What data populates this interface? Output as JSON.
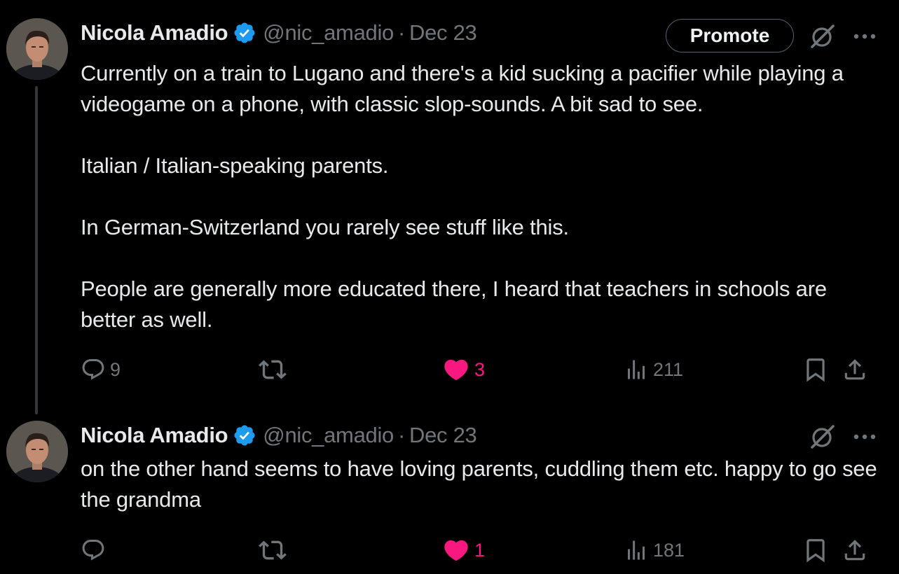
{
  "tweets": [
    {
      "author": {
        "name": "Nicola Amadio",
        "handle": "@nic_amadio",
        "verified": true
      },
      "separator": "·",
      "date": "Dec 23",
      "promote_label": "Promote",
      "paragraphs": [
        "Currently on a train to Lugano and there's a kid sucking a pacifier while playing a videogame on a phone, with classic slop-sounds. A bit sad to see.",
        "Italian / Italian-speaking parents.",
        "In German-Switzerland you rarely see stuff like this.",
        "People are generally more educated there, I heard that teachers in schools are better as well."
      ],
      "stats": {
        "replies": "9",
        "retweets": "",
        "likes": "3",
        "views": "211"
      },
      "liked": true
    },
    {
      "author": {
        "name": "Nicola Amadio",
        "handle": "@nic_amadio",
        "verified": true
      },
      "separator": "·",
      "date": "Dec 23",
      "paragraphs": [
        "on the other hand seems to have loving parents, cuddling them etc. happy to go see the grandma"
      ],
      "stats": {
        "replies": "",
        "retweets": "",
        "likes": "1",
        "views": "181"
      },
      "liked": true
    }
  ],
  "colors": {
    "background": "#000000",
    "text_primary": "#e7e9ea",
    "text_secondary": "#71767b",
    "verified_blue": "#1d9bf0",
    "like_pink": "#f91880",
    "thread_line": "#333639"
  },
  "icons": {
    "verified": "verified-badge-icon",
    "grok": "grok-icon",
    "more": "more-dots-icon",
    "reply": "reply-icon",
    "retweet": "retweet-icon",
    "like": "heart-icon",
    "views": "views-icon",
    "bookmark": "bookmark-icon",
    "share": "share-icon"
  }
}
